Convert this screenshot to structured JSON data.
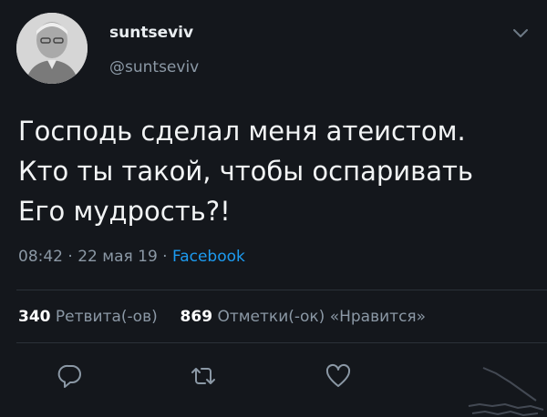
{
  "user": {
    "display_name": "suntseviv",
    "handle": "@suntseviv"
  },
  "tweet": {
    "lines": [
      "Господь сделал меня атеистом.",
      "Кто ты такой, чтобы оспаривать",
      "Его мудрость?!"
    ],
    "time": "08:42",
    "date": "22 мая 19",
    "separator": "·",
    "source": "Facebook"
  },
  "stats": {
    "retweets_count": "340",
    "retweets_label": "Ретвита(-ов)",
    "likes_count": "869",
    "likes_label": "Отметки(-ок) «Нравится»"
  },
  "icons": {
    "menu": "chevron-down-icon",
    "reply": "reply-icon",
    "retweet": "retweet-icon",
    "like": "heart-icon"
  },
  "colors": {
    "background": "#14171c",
    "link": "#1d9bf0",
    "muted": "#8b98a5",
    "text": "#f2f4f5"
  }
}
